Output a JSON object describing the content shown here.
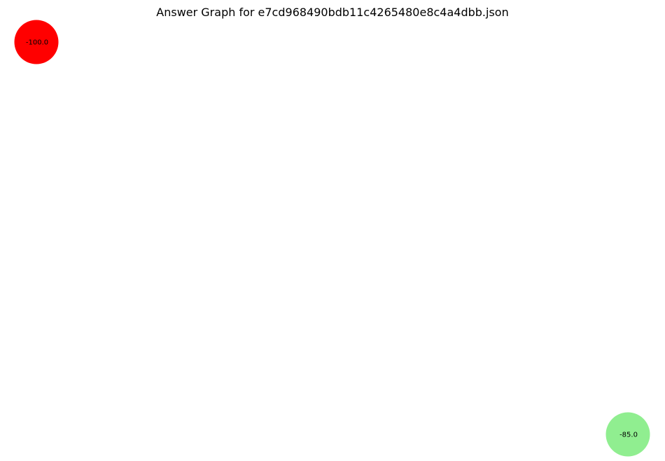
{
  "title": "Answer Graph for e7cd968490bdb11c4265480e8c4a4dbb.json",
  "nodes": [
    {
      "id": "node-1",
      "label": "-100.0",
      "color": "#ff0000"
    },
    {
      "id": "node-2",
      "label": "-85.0",
      "color": "#90ee90"
    }
  ],
  "edges": []
}
